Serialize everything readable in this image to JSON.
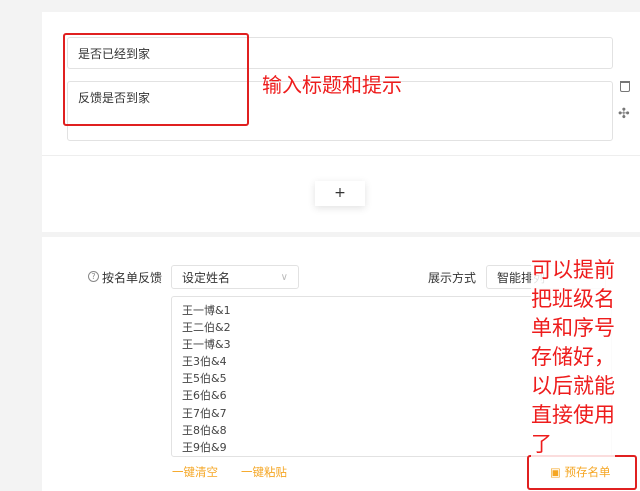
{
  "question": {
    "title_value": "是否已经到家",
    "hint_value": "反馈是否到家"
  },
  "annotation_top": "输入标题和提示",
  "add_button": "+",
  "roster": {
    "label": "按名单反馈",
    "name_select": "设定姓名",
    "display_label": "展示方式",
    "display_select": "智能排列",
    "names": [
      "王一博&1",
      "王二伯&2",
      "王一博&3",
      "王3伯&4",
      "王5伯&5",
      "王6伯&6",
      "王7伯&7",
      "王8伯&8",
      "王9伯&9"
    ],
    "clear_link": "一键清空",
    "paste_link": "一键粘贴",
    "save_button": "预存名单"
  },
  "annotation_right": [
    "可以提前",
    "把班级名",
    "单和序号",
    "存储好，",
    "以后就能",
    "直接使用",
    "了"
  ]
}
